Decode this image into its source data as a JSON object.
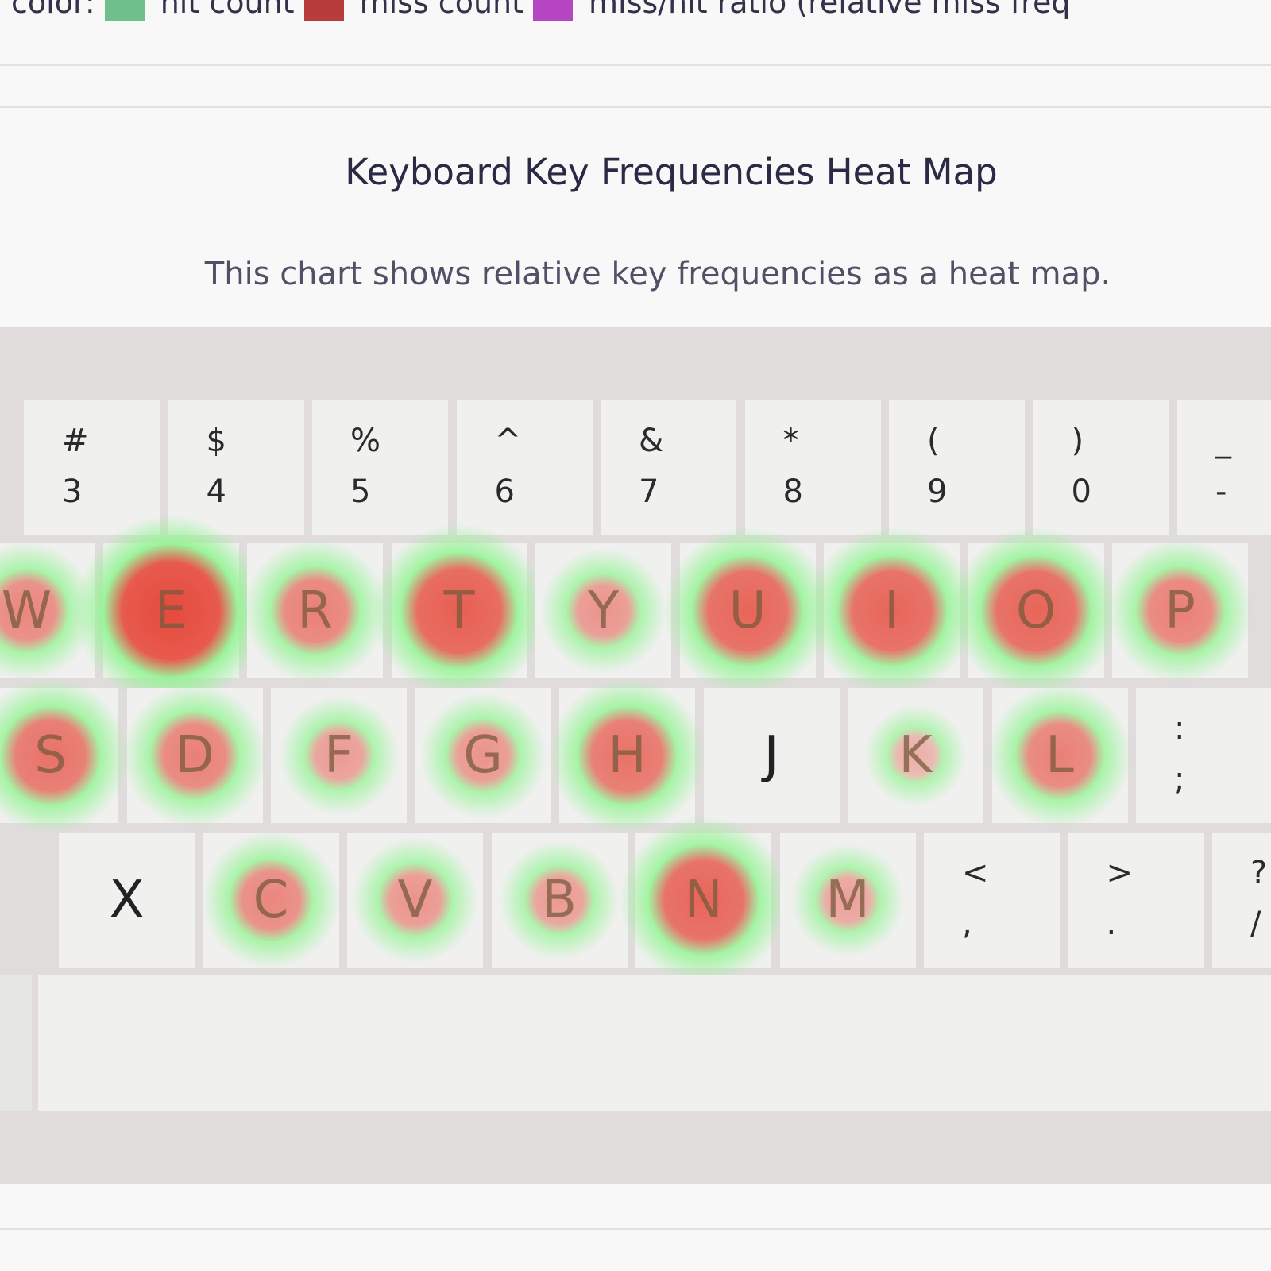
{
  "legend": {
    "items": [
      {
        "text": "color:",
        "swatch": "#6fbf8d"
      },
      {
        "text": "hit count",
        "swatch": "#b83c3c"
      },
      {
        "text": "miss count",
        "swatch": "#b645c2"
      },
      {
        "text": "miss/hit ratio (relative miss freq",
        "swatch": ""
      }
    ]
  },
  "chart": {
    "title": "Keyboard Key Frequencies Heat Map",
    "description": "This chart shows relative key frequencies as a heat map."
  },
  "colors": {
    "heat_hot": "#e64a3c",
    "heat_glow": "#8ef58e",
    "key_face": "#f0f0ef",
    "keyboard_frame": "#e0dcdc"
  },
  "keyboard": {
    "number_row": [
      {
        "upper": "#",
        "lower": "3"
      },
      {
        "upper": "$",
        "lower": "4"
      },
      {
        "upper": "%",
        "lower": "5"
      },
      {
        "upper": "^",
        "lower": "6"
      },
      {
        "upper": "&",
        "lower": "7"
      },
      {
        "upper": "*",
        "lower": "8"
      },
      {
        "upper": "(",
        "lower": "9"
      },
      {
        "upper": ")",
        "lower": "0"
      },
      {
        "upper": "_",
        "lower": "-"
      }
    ],
    "top_row": [
      {
        "label": "W",
        "heat": 0.55
      },
      {
        "label": "E",
        "heat": 1.0
      },
      {
        "label": "R",
        "heat": 0.6
      },
      {
        "label": "T",
        "heat": 0.85
      },
      {
        "label": "Y",
        "heat": 0.45
      },
      {
        "label": "U",
        "heat": 0.8
      },
      {
        "label": "I",
        "heat": 0.8
      },
      {
        "label": "O",
        "heat": 0.8
      },
      {
        "label": "P",
        "heat": 0.6
      }
    ],
    "home_row": [
      {
        "label": "S",
        "heat": 0.7
      },
      {
        "label": "D",
        "heat": 0.6
      },
      {
        "label": "F",
        "heat": 0.4
      },
      {
        "label": "G",
        "heat": 0.45
      },
      {
        "label": "H",
        "heat": 0.7
      },
      {
        "label": "J",
        "heat": 0.0
      },
      {
        "label": "K",
        "heat": 0.25
      },
      {
        "label": "L",
        "heat": 0.6
      },
      {
        "upper": ":",
        "lower": ";",
        "heat": 0.0
      }
    ],
    "bottom_row": [
      {
        "label": "X",
        "heat": 0.0
      },
      {
        "label": "C",
        "heat": 0.55
      },
      {
        "label": "V",
        "heat": 0.45
      },
      {
        "label": "B",
        "heat": 0.4
      },
      {
        "label": "N",
        "heat": 0.8
      },
      {
        "label": "M",
        "heat": 0.35
      },
      {
        "upper": "<",
        "lower": ",",
        "heat": 0.0
      },
      {
        "upper": ">",
        "lower": ".",
        "heat": 0.0
      },
      {
        "upper": "?",
        "lower": "/",
        "heat": 0.0
      }
    ]
  }
}
